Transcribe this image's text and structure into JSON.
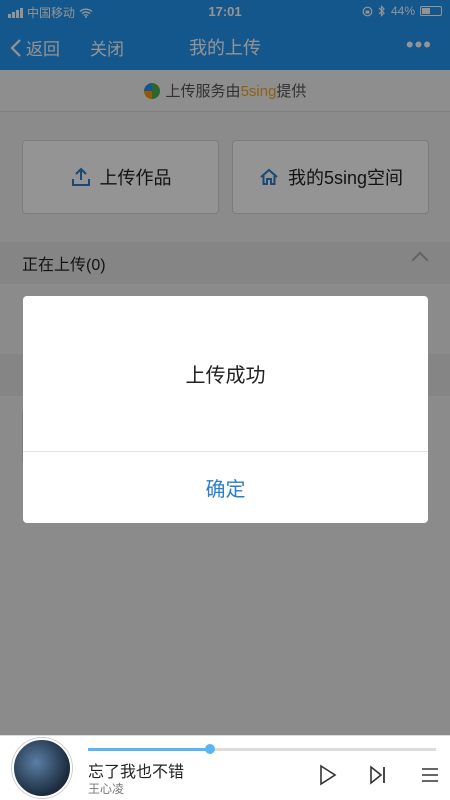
{
  "status": {
    "carrier": "中国移动",
    "time": "17:01",
    "battery": "44%"
  },
  "nav": {
    "back_label": "返回",
    "close_label": "关闭",
    "title": "我的上传",
    "more_label": "•••"
  },
  "provider": {
    "prefix": "上传服务由",
    "brand": "5sing",
    "suffix": "提供"
  },
  "buttons": {
    "upload_label": "上传作品",
    "space_label": "我的5sing空间"
  },
  "uploading_section": {
    "title": "正在上传(0)"
  },
  "dialog": {
    "message": "上传成功",
    "confirm_label": "确定"
  },
  "player": {
    "song_title": "忘了我也不错",
    "artist": "王心凌",
    "progress": 0.35
  },
  "colors": {
    "accent": "#2196f3",
    "brand_orange": "#f5a623",
    "confirm_blue": "#2b7ec8",
    "progress": "#5ab5f0"
  }
}
